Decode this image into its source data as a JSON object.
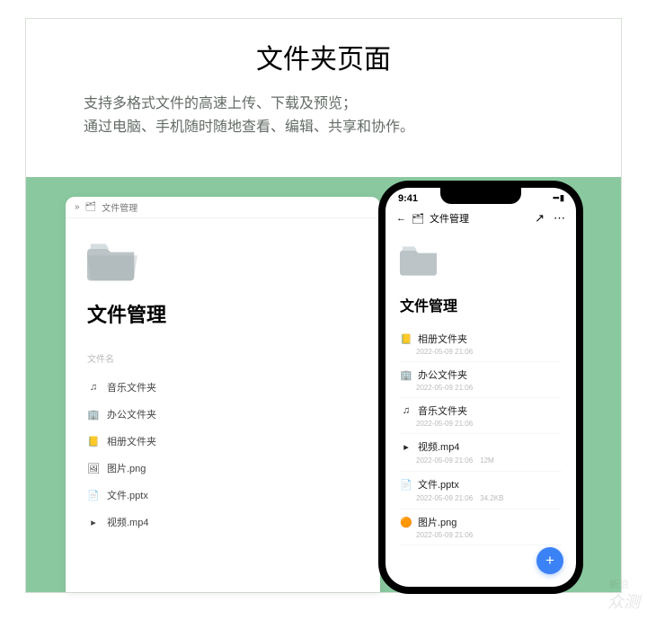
{
  "header": {
    "title": "文件夹页面",
    "sub1": "支持多格式文件的高速上传、下载及预览；",
    "sub2": "通过电脑、手机随时随地查看、编辑、共享和协作。"
  },
  "desktop": {
    "crumb_icon": "»",
    "crumb": "文件管理",
    "heading": "文件管理",
    "col": "文件名",
    "rows": [
      {
        "icon": "♫",
        "name": "音乐文件夹"
      },
      {
        "icon": "🏢",
        "name": "办公文件夹"
      },
      {
        "icon": "📒",
        "name": "相册文件夹"
      },
      {
        "icon": "🖼",
        "name": "图片.png"
      },
      {
        "icon": "📄",
        "name": "文件.pptx"
      },
      {
        "icon": "▸",
        "name": "视频.mp4"
      }
    ]
  },
  "phone": {
    "time": "9:41",
    "crumb": "文件管理",
    "heading": "文件管理",
    "back": "←",
    "share": "↗",
    "more": "⋯",
    "signal": "▪▪▪ ▮",
    "fab": "+",
    "rows": [
      {
        "icon": "📒",
        "name": "相册文件夹",
        "meta": "2022-05-09 21:06"
      },
      {
        "icon": "🏢",
        "name": "办公文件夹",
        "meta": "2022-05-09 21:06"
      },
      {
        "icon": "♫",
        "name": "音乐文件夹",
        "meta": "2022-05-09 21:06"
      },
      {
        "icon": "▸",
        "name": "视频.mp4",
        "meta": "2022-05-09 21:06　12M"
      },
      {
        "icon": "📄",
        "name": "文件.pptx",
        "meta": "2022-05-09 21:06　34.2KB"
      },
      {
        "icon": "🟠",
        "name": "图片.png",
        "meta": "2022-05-09 21:06"
      }
    ]
  },
  "watermark": {
    "brand": "新浪",
    "sub": "众测"
  }
}
